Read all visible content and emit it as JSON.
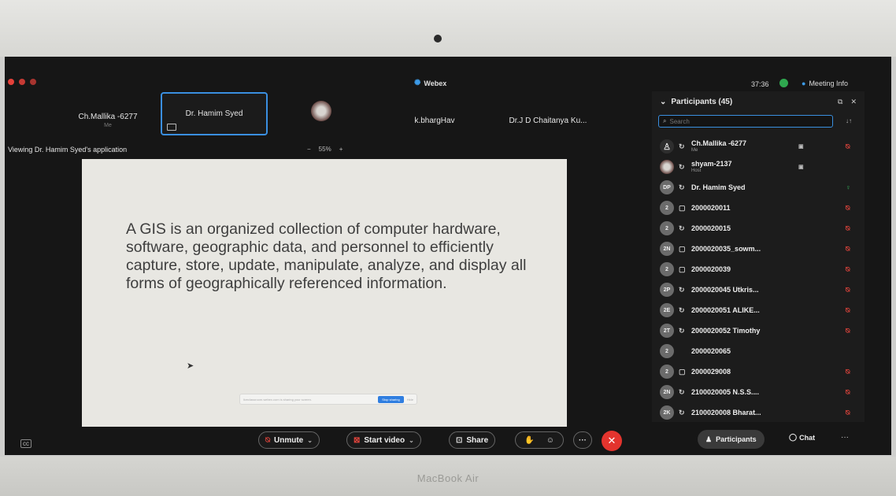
{
  "app": {
    "title": "Webex",
    "timer": "37:36",
    "meeting_info": "Meeting Info"
  },
  "tiles": [
    {
      "name": "Ch.Mallika -6277",
      "sub": "Me"
    },
    {
      "name": "Dr. Hamim Syed"
    },
    {
      "name": "k.bhargHav"
    },
    {
      "name": "Dr.J D Chaitanya Ku..."
    }
  ],
  "share": {
    "viewing": "Viewing Dr. Hamim Syed's application",
    "zoom_minus": "−",
    "zoom_level": "55%",
    "zoom_plus": "+"
  },
  "slide": {
    "text": "A GIS is an organized collection of computer hardware, software, geographic data, and personnel to efficiently capture, store, update, manipulate, analyze, and display all forms of geographically referenced information.",
    "share_notice": "liveclassroom.webex.com is sharing your screen.",
    "stop_label": "Stop sharing",
    "hide_label": "Hide"
  },
  "participants": {
    "title": "Participants (45)",
    "search_placeholder": "Search",
    "list": [
      {
        "initials": "",
        "name": "Ch.Mallika -6277",
        "sub": "Me",
        "mic": "muted"
      },
      {
        "initials": "",
        "name": "shyam-2137",
        "sub": "Host",
        "mic": "none"
      },
      {
        "initials": "DP",
        "name": "Dr. Hamim Syed",
        "sub": "",
        "mic": "on"
      },
      {
        "initials": "2",
        "name": "2000020011",
        "sub": "",
        "mic": "muted"
      },
      {
        "initials": "2",
        "name": "2000020015",
        "sub": "",
        "mic": "muted"
      },
      {
        "initials": "2N",
        "name": "2000020035_sowm...",
        "sub": "",
        "mic": "muted"
      },
      {
        "initials": "2",
        "name": "2000020039",
        "sub": "",
        "mic": "muted"
      },
      {
        "initials": "2P",
        "name": "2000020045 Utkris...",
        "sub": "",
        "mic": "muted"
      },
      {
        "initials": "2E",
        "name": "2000020051 ALIKE...",
        "sub": "",
        "mic": "muted"
      },
      {
        "initials": "2T",
        "name": "2000020052 Timothy",
        "sub": "",
        "mic": "muted"
      },
      {
        "initials": "2",
        "name": "2000020065",
        "sub": "",
        "mic": "none"
      },
      {
        "initials": "2",
        "name": "2000029008",
        "sub": "",
        "mic": "muted"
      },
      {
        "initials": "2N",
        "name": "2100020005 N.S.S....",
        "sub": "",
        "mic": "muted"
      },
      {
        "initials": "2K",
        "name": "2100020008 Bharat...",
        "sub": "",
        "mic": "muted"
      }
    ]
  },
  "controls": {
    "unmute": "Unmute",
    "start_video": "Start video",
    "share": "Share",
    "participants": "Participants",
    "chat": "Chat",
    "more": "···"
  },
  "device": {
    "brand": "MacBook Air"
  },
  "colors": {
    "accent": "#3a8fe0",
    "end_call": "#e3342e",
    "muted": "#e0443c",
    "active_mic": "#34b15a"
  }
}
